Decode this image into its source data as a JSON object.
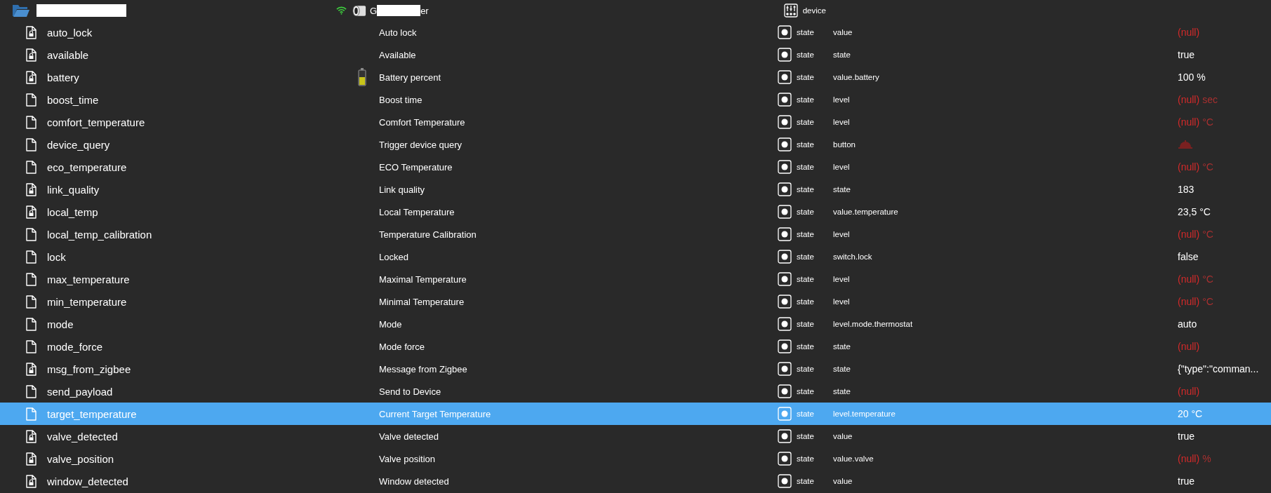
{
  "header": {
    "device_prefix": "G",
    "device_suffix": "er",
    "role": "device"
  },
  "rows": [
    {
      "name": "auto_lock",
      "readonly": true,
      "title": "Auto lock",
      "type": "state",
      "role": "value",
      "value": {
        "kind": "null",
        "text": "(null)"
      },
      "selected": false
    },
    {
      "name": "available",
      "readonly": true,
      "title": "Available",
      "type": "state",
      "role": "state",
      "value": {
        "kind": "text",
        "text": "true"
      },
      "selected": false
    },
    {
      "name": "battery",
      "readonly": true,
      "battery_icon": true,
      "title": "Battery percent",
      "type": "state",
      "role": "value.battery",
      "value": {
        "kind": "text",
        "text": "100 %"
      },
      "selected": false
    },
    {
      "name": "boost_time",
      "readonly": false,
      "title": "Boost time",
      "type": "state",
      "role": "level",
      "value": {
        "kind": "null",
        "text": "(null)",
        "unit": "sec"
      },
      "selected": false
    },
    {
      "name": "comfort_temperature",
      "readonly": false,
      "title": "Comfort Temperature",
      "type": "state",
      "role": "level",
      "value": {
        "kind": "null",
        "text": "(null)",
        "unit": "°C"
      },
      "selected": false
    },
    {
      "name": "device_query",
      "readonly": false,
      "title": "Trigger device query",
      "type": "state",
      "role": "button",
      "value": {
        "kind": "button"
      },
      "selected": false
    },
    {
      "name": "eco_temperature",
      "readonly": false,
      "title": "ECO Temperature",
      "type": "state",
      "role": "level",
      "value": {
        "kind": "null",
        "text": "(null)",
        "unit": "°C"
      },
      "selected": false
    },
    {
      "name": "link_quality",
      "readonly": true,
      "title": "Link quality",
      "type": "state",
      "role": "state",
      "value": {
        "kind": "text",
        "text": "183"
      },
      "selected": false
    },
    {
      "name": "local_temp",
      "readonly": true,
      "title": "Local Temperature",
      "type": "state",
      "role": "value.temperature",
      "value": {
        "kind": "text",
        "text": "23,5 °C"
      },
      "selected": false
    },
    {
      "name": "local_temp_calibration",
      "readonly": false,
      "title": "Temperature Calibration",
      "type": "state",
      "role": "level",
      "value": {
        "kind": "null",
        "text": "(null)",
        "unit": "°C"
      },
      "selected": false
    },
    {
      "name": "lock",
      "readonly": false,
      "title": "Locked",
      "type": "state",
      "role": "switch.lock",
      "value": {
        "kind": "text",
        "text": "false"
      },
      "selected": false
    },
    {
      "name": "max_temperature",
      "readonly": false,
      "title": "Maximal Temperature",
      "type": "state",
      "role": "level",
      "value": {
        "kind": "null",
        "text": "(null)",
        "unit": "°C"
      },
      "selected": false
    },
    {
      "name": "min_temperature",
      "readonly": false,
      "title": "Minimal Temperature",
      "type": "state",
      "role": "level",
      "value": {
        "kind": "null",
        "text": "(null)",
        "unit": "°C"
      },
      "selected": false
    },
    {
      "name": "mode",
      "readonly": false,
      "title": "Mode",
      "type": "state",
      "role": "level.mode.thermostat",
      "value": {
        "kind": "text",
        "text": "auto"
      },
      "selected": false
    },
    {
      "name": "mode_force",
      "readonly": false,
      "title": "Mode force",
      "type": "state",
      "role": "state",
      "value": {
        "kind": "null",
        "text": "(null)"
      },
      "selected": false
    },
    {
      "name": "msg_from_zigbee",
      "readonly": true,
      "title": "Message from Zigbee",
      "type": "state",
      "role": "state",
      "value": {
        "kind": "text",
        "text": "{\"type\":\"comman..."
      },
      "selected": false
    },
    {
      "name": "send_payload",
      "readonly": false,
      "title": "Send to Device",
      "type": "state",
      "role": "state",
      "value": {
        "kind": "null",
        "text": "(null)"
      },
      "selected": false
    },
    {
      "name": "target_temperature",
      "readonly": false,
      "title": "Current Target Temperature",
      "type": "state",
      "role": "level.temperature",
      "value": {
        "kind": "text",
        "text": "20 °C"
      },
      "selected": true
    },
    {
      "name": "valve_detected",
      "readonly": true,
      "title": "Valve detected",
      "type": "state",
      "role": "value",
      "value": {
        "kind": "text",
        "text": "true"
      },
      "selected": false
    },
    {
      "name": "valve_position",
      "readonly": true,
      "title": "Valve position",
      "type": "state",
      "role": "value.valve",
      "value": {
        "kind": "null",
        "text": "(null)",
        "unit": "%"
      },
      "selected": false
    },
    {
      "name": "window_detected",
      "readonly": true,
      "title": "Window detected",
      "type": "state",
      "role": "value",
      "value": {
        "kind": "text",
        "text": "true"
      },
      "selected": false
    }
  ]
}
